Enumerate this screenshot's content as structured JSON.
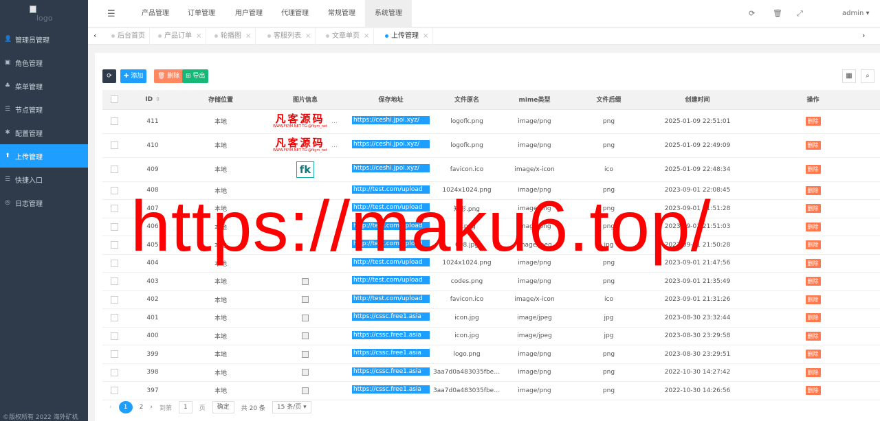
{
  "sidebar": {
    "logo_alt": "logo",
    "items": [
      {
        "label": "管理员管理",
        "icon": "user-icon",
        "glyph": "👤"
      },
      {
        "label": "角色管理",
        "icon": "id-card-icon",
        "glyph": "▣"
      },
      {
        "label": "菜单管理",
        "icon": "tree-icon",
        "glyph": "♣"
      },
      {
        "label": "节点管理",
        "icon": "list-icon",
        "glyph": "☰"
      },
      {
        "label": "配置管理",
        "icon": "gear-icon",
        "glyph": "✱"
      },
      {
        "label": "上传管理",
        "icon": "upload-icon",
        "glyph": "⬆"
      },
      {
        "label": "快捷入口",
        "icon": "list-icon",
        "glyph": "☰"
      },
      {
        "label": "日志管理",
        "icon": "globe-icon",
        "glyph": "◎"
      }
    ],
    "active_index": 5,
    "copyright": "©版权所有 2022 海外矿机"
  },
  "topbar": {
    "tabs": [
      "产品管理",
      "订单管理",
      "用户管理",
      "代理管理",
      "常规管理",
      "系统管理"
    ],
    "active": "系统管理",
    "user": "admin ▾"
  },
  "tabstrip": {
    "tabs": [
      "后台首页",
      "产品订单",
      "轮播图",
      "客服列表",
      "文章单页",
      "上传管理"
    ],
    "active": "上传管理"
  },
  "toolbar": {
    "refresh": "⟳",
    "add": "✚ 添加",
    "delete": "🗑 删除",
    "export": "⊞ 导出"
  },
  "table": {
    "headers": [
      "ID",
      "存储位置",
      "图片信息",
      "保存地址",
      "文件原名",
      "mime类型",
      "文件后缀",
      "创建时间",
      "操作"
    ],
    "rows": [
      {
        "id": "411",
        "storage": "本地",
        "image": "logo",
        "url": "https://ceshi.jpoi.xyz/",
        "name": "logofk.png",
        "mime": "image/png",
        "ext": "png",
        "time": "2025-01-09 22:51:01"
      },
      {
        "id": "410",
        "storage": "本地",
        "image": "logo",
        "url": "https://ceshi.jpoi.xyz/",
        "name": "logofk.png",
        "mime": "image/png",
        "ext": "png",
        "time": "2025-01-09 22:49:09"
      },
      {
        "id": "409",
        "storage": "本地",
        "image": "fk",
        "url": "https://ceshi.jpoi.xyz/",
        "name": "favicon.ico",
        "mime": "image/x-icon",
        "ext": "ico",
        "time": "2025-01-09 22:48:34"
      },
      {
        "id": "408",
        "storage": "本地",
        "image": "none",
        "url": "http://test.com/upload",
        "name": "1024x1024.png",
        "mime": "image/png",
        "ext": "png",
        "time": "2023-09-01 22:08:45"
      },
      {
        "id": "407",
        "storage": "本地",
        "image": "none",
        "url": "http://test.com/upload",
        "name": "矩形.png",
        "mime": "image/png",
        "ext": "png",
        "time": "2023-09-01 21:51:28"
      },
      {
        "id": "406",
        "storage": "本地",
        "image": "none",
        "url": "http://test.com/upload",
        "name": "h.png",
        "mime": "image/png",
        "ext": "png",
        "time": "2023-09-01 21:51:03"
      },
      {
        "id": "405",
        "storage": "本地",
        "image": "none",
        "url": "http://test.com/upload",
        "name": "008.jpg",
        "mime": "image/jpeg",
        "ext": "jpg",
        "time": "2023-09-01 21:50:28"
      },
      {
        "id": "404",
        "storage": "本地",
        "image": "none",
        "url": "http://test.com/upload",
        "name": "1024x1024.png",
        "mime": "image/png",
        "ext": "png",
        "time": "2023-09-01 21:47:56"
      },
      {
        "id": "403",
        "storage": "本地",
        "image": "broken",
        "url": "http://test.com/upload",
        "name": "codes.png",
        "mime": "image/png",
        "ext": "png",
        "time": "2023-09-01 21:35:49"
      },
      {
        "id": "402",
        "storage": "本地",
        "image": "broken",
        "url": "http://test.com/upload",
        "name": "favicon.ico",
        "mime": "image/x-icon",
        "ext": "ico",
        "time": "2023-09-01 21:31:26"
      },
      {
        "id": "401",
        "storage": "本地",
        "image": "broken",
        "url": "https://cssc.free1.asia",
        "name": "icon.jpg",
        "mime": "image/jpeg",
        "ext": "jpg",
        "time": "2023-08-30 23:32:44"
      },
      {
        "id": "400",
        "storage": "本地",
        "image": "broken",
        "url": "https://cssc.free1.asia",
        "name": "icon.jpg",
        "mime": "image/jpeg",
        "ext": "jpg",
        "time": "2023-08-30 23:29:58"
      },
      {
        "id": "399",
        "storage": "本地",
        "image": "broken",
        "url": "https://cssc.free1.asia",
        "name": "logo.png",
        "mime": "image/png",
        "ext": "png",
        "time": "2023-08-30 23:29:51"
      },
      {
        "id": "398",
        "storage": "本地",
        "image": "broken",
        "url": "https://cssc.free1.asia",
        "name": "3aa7d0a483035fbe60...",
        "mime": "image/png",
        "ext": "png",
        "time": "2022-10-30 14:27:42"
      },
      {
        "id": "397",
        "storage": "本地",
        "image": "broken",
        "url": "https://cssc.free1.asia",
        "name": "3aa7d0a483035fbe60...",
        "mime": "image/png",
        "ext": "png",
        "time": "2022-10-30 14:26:56"
      }
    ],
    "action_label": "删除",
    "logo_big": "凡客源码",
    "logo_small": "WWW.FKYM.NET    TG:@fkym_net",
    "fk_text": "fk"
  },
  "pagination": {
    "prev": "‹",
    "current": "1",
    "page2": "2",
    "next": "›",
    "goto_label": "到第",
    "goto_value": "1",
    "page_unit": "页",
    "confirm": "确定",
    "total": "共 20 条",
    "page_size": "15 条/页 ▾"
  },
  "watermark": "https://maku6.top/",
  "colors": {
    "accent": "#1e9fff",
    "sidebar": "#2f3b4b",
    "danger": "#ff5722",
    "success": "#16b777",
    "watermark": "#ff0000"
  }
}
